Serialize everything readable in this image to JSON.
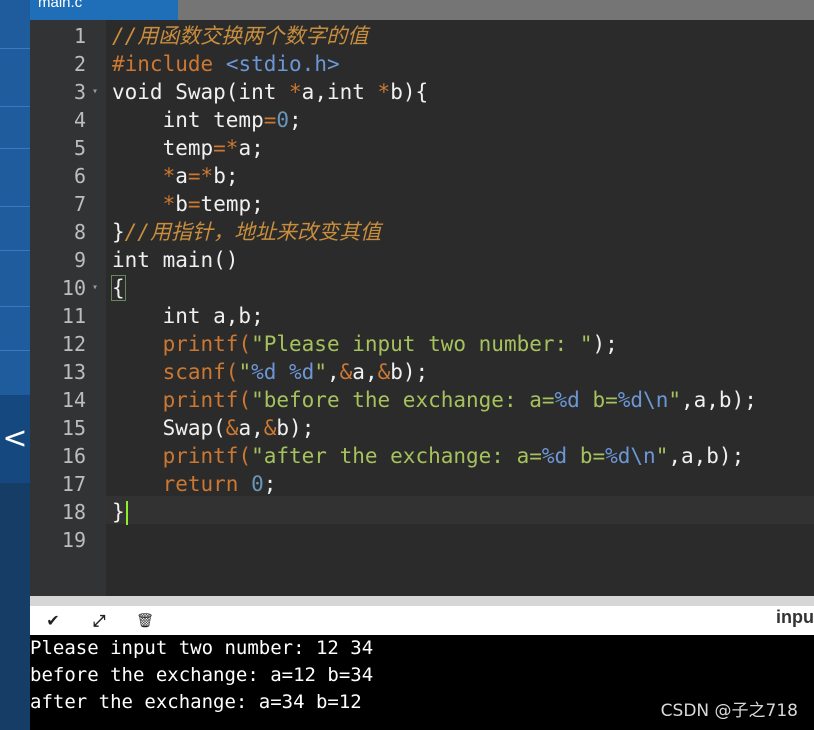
{
  "tab": {
    "label": "main.c"
  },
  "editor": {
    "line_numbers": [
      "1",
      "2",
      "3",
      "4",
      "5",
      "6",
      "7",
      "8",
      "9",
      "10",
      "11",
      "12",
      "13",
      "14",
      "15",
      "16",
      "17",
      "18",
      "19"
    ],
    "fold_markers": [
      "▾",
      "▾"
    ],
    "lines": {
      "l1": {
        "cm": "//用函数交换两个数字的值"
      },
      "l2": {
        "pp": "#include",
        "sp": " ",
        "hd": "<stdio.h>"
      },
      "l3": {
        "a": "void Swap(int ",
        "op1": "*",
        "b": "a,int ",
        "op2": "*",
        "c": "b){"
      },
      "l4": {
        "a": "    int temp",
        "op": "=",
        "nm": "0",
        "b": ";"
      },
      "l5": {
        "a": "    temp",
        "op": "=*",
        "b": "a;"
      },
      "l6": {
        "ind": "    ",
        "op1": "*",
        "a": "a",
        "op2": "=*",
        "b": "b;"
      },
      "l7": {
        "ind": "    ",
        "op1": "*",
        "a": "b",
        "op2": "=",
        "b": "temp;"
      },
      "l8": {
        "a": "}",
        "cm": "//用指针，地址来改变其值"
      },
      "l9": {
        "a": "int main()"
      },
      "l10": {
        "a": "{"
      },
      "l11": {
        "a": "    int a,b;"
      },
      "l12": {
        "ind": "    ",
        "fn": "printf",
        "p1": "(",
        "st": "\"Please input two number: \"",
        "p2": ");"
      },
      "l13": {
        "ind": "    ",
        "fn": "scanf",
        "p1": "(",
        "q1": "\"",
        "f1": "%d %d",
        "q2": "\"",
        "c": ",",
        "op1": "&",
        "a": "a,",
        "op2": "&",
        "b": "b);"
      },
      "l14": {
        "ind": "    ",
        "fn": "printf",
        "p1": "(",
        "st1": "\"before the exchange: a=",
        "f1": "%d",
        "st2": " b=",
        "f2": "%d\\n",
        "st3": "\"",
        "rest": ",a,b);"
      },
      "l15": {
        "a": "    Swap(",
        "op1": "&",
        "b": "a,",
        "op2": "&",
        "c": "b);"
      },
      "l16": {
        "ind": "    ",
        "fn": "printf",
        "p1": "(",
        "st1": "\"after the exchange: a=",
        "f1": "%d",
        "st2": " b=",
        "f2": "%d\\n",
        "st3": "\"",
        "rest": ",a,b);"
      },
      "l17": {
        "ind": "    ",
        "kw": "return",
        "sp": " ",
        "nm": "0",
        "b": ";"
      },
      "l18": {
        "a": "}"
      },
      "l19": {
        "a": ""
      }
    }
  },
  "console": {
    "label": "inpu",
    "buttons": {
      "collapse": "✔",
      "expand": "⤢",
      "clear": "🗑"
    },
    "output": [
      "Please input two number: 12 34",
      "before the exchange: a=12 b=34",
      "after the exchange: a=34 b=12"
    ]
  },
  "sidebar": {
    "collapse_glyph": "<"
  },
  "watermark": "CSDN @子之718",
  "colors": {
    "sidebar": "#1f5c9e",
    "tab": "#1f6fb8",
    "editor_bg": "#2b2b2b",
    "console_bg": "#000000",
    "caret": "#8ef02b"
  }
}
